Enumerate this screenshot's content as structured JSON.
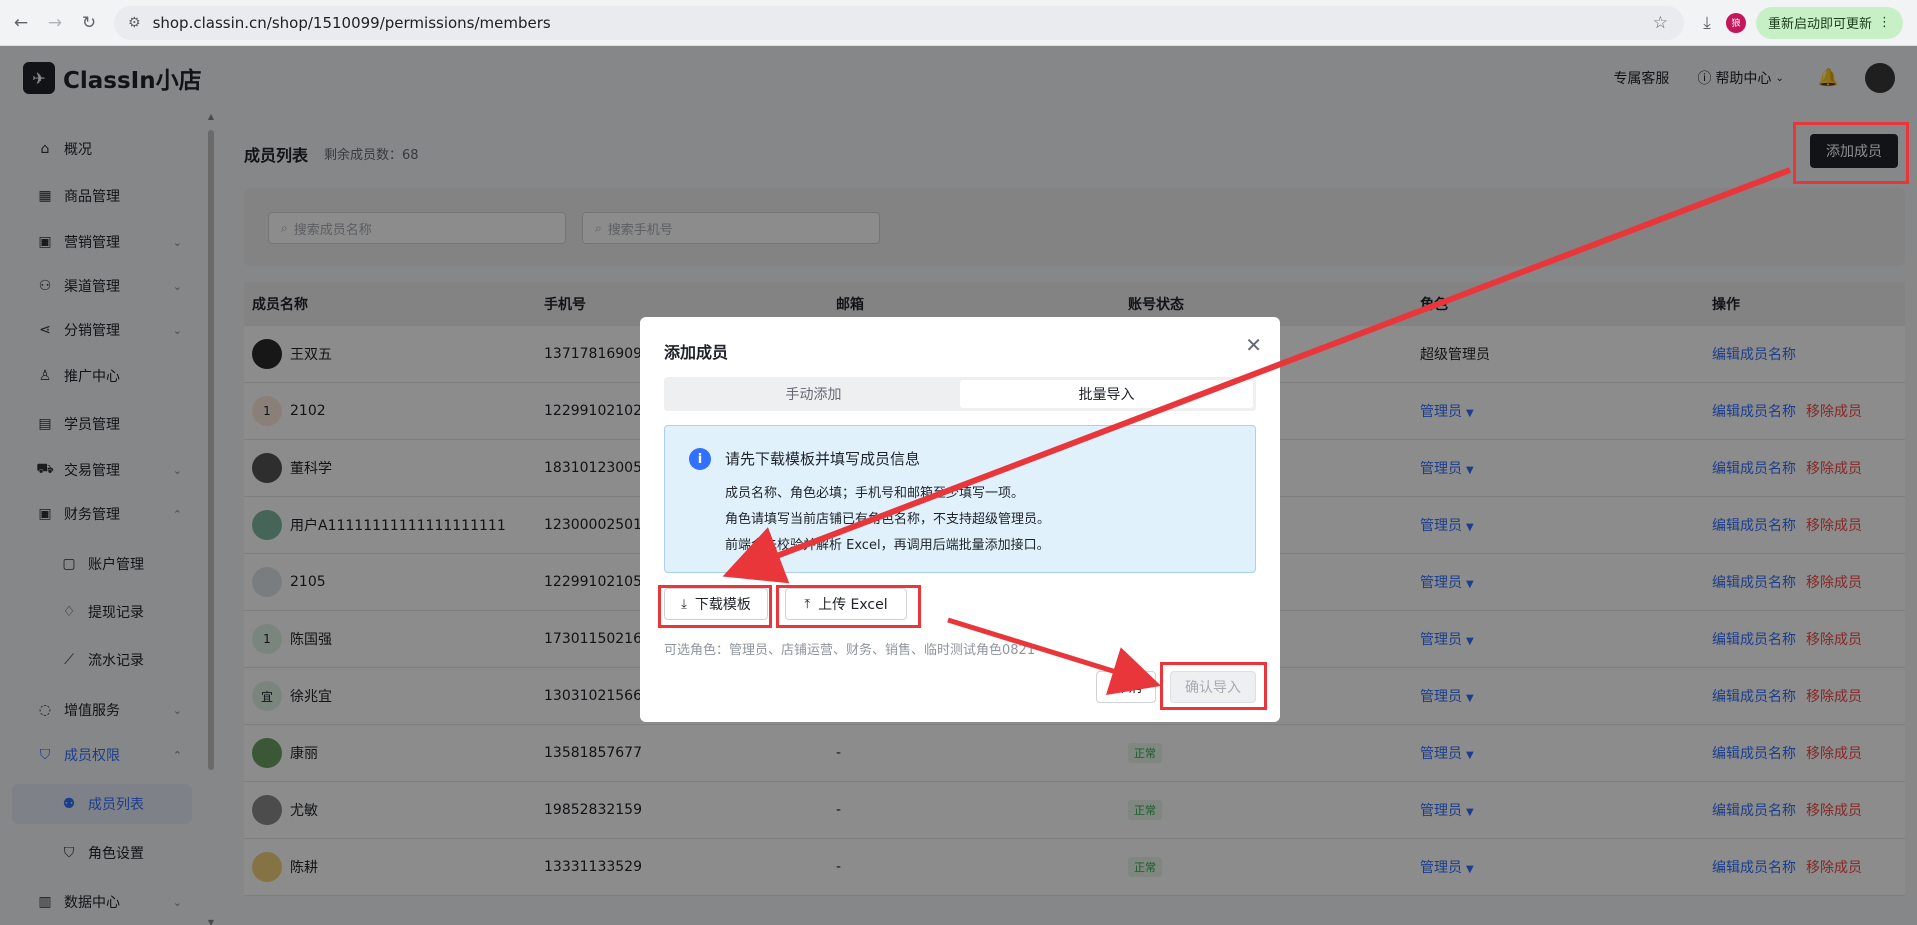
{
  "browser": {
    "url": "shop.classin.cn/shop/1510099/permissions/members",
    "ext_badge": "狼",
    "update_label": "重新启动即可更新"
  },
  "header": {
    "logo_text": "ClassIn小店",
    "service": "专属客服",
    "help": "帮助中心"
  },
  "sidebar": {
    "items": [
      {
        "label": "概况",
        "icon": "home-icon"
      },
      {
        "label": "商品管理",
        "icon": "grid-icon"
      },
      {
        "label": "营销管理",
        "icon": "gift-icon"
      },
      {
        "label": "渠道管理",
        "icon": "channel-icon"
      },
      {
        "label": "分销管理",
        "icon": "share-icon"
      },
      {
        "label": "推广中心",
        "icon": "promo-icon"
      },
      {
        "label": "学员管理",
        "icon": "student-icon"
      },
      {
        "label": "交易管理",
        "icon": "cart-icon"
      },
      {
        "label": "财务管理",
        "icon": "finance-icon"
      },
      {
        "label": "账户管理",
        "icon": "wallet-icon"
      },
      {
        "label": "提现记录",
        "icon": "withdraw-icon"
      },
      {
        "label": "流水记录",
        "icon": "trend-icon"
      },
      {
        "label": "增值服务",
        "icon": "chat-icon"
      },
      {
        "label": "成员权限",
        "icon": "shield-icon"
      },
      {
        "label": "成员列表",
        "icon": "members-icon"
      },
      {
        "label": "角色设置",
        "icon": "role-icon"
      },
      {
        "label": "数据中心",
        "icon": "chart-icon"
      }
    ]
  },
  "main": {
    "title": "成员列表",
    "remaining": "剩余成员数：68",
    "add_button": "添加成员",
    "search_name_placeholder": "搜索成员名称",
    "search_phone_placeholder": "搜索手机号",
    "columns": [
      "成员名称",
      "手机号",
      "邮箱",
      "账号状态",
      "角色",
      "操作"
    ],
    "rows": [
      {
        "name": "王双五",
        "phone": "13717816909",
        "email": "",
        "status": "",
        "role": "超级管理员",
        "edit": "编辑成员名称",
        "remove": "",
        "avatar_text": "",
        "avatar_color": "#2b2b2b"
      },
      {
        "name": "2102",
        "phone": "12299102102",
        "email": "",
        "status": "",
        "role": "管理员",
        "edit": "编辑成员名称",
        "remove": "移除成员",
        "avatar_text": "1",
        "avatar_color": "#fbe9dd"
      },
      {
        "name": "董科学",
        "phone": "18310123005",
        "email": "",
        "status": "",
        "role": "管理员",
        "edit": "编辑成员名称",
        "remove": "移除成员",
        "avatar_text": "",
        "avatar_color": "#555555"
      },
      {
        "name": "用户A11111111111111111111",
        "phone": "12300002501",
        "email": "",
        "status": "",
        "role": "管理员",
        "edit": "编辑成员名称",
        "remove": "移除成员",
        "avatar_text": "",
        "avatar_color": "#7fb8a0"
      },
      {
        "name": "2105",
        "phone": "12299102105",
        "email": "",
        "status": "",
        "role": "管理员",
        "edit": "编辑成员名称",
        "remove": "移除成员",
        "avatar_text": "",
        "avatar_color": "#dfe3ea"
      },
      {
        "name": "陈国强",
        "phone": "17301150216",
        "email": "",
        "status": "",
        "role": "管理员",
        "edit": "编辑成员名称",
        "remove": "移除成员",
        "avatar_text": "1",
        "avatar_color": "#dff3e4"
      },
      {
        "name": "徐兆宜",
        "phone": "13031021566",
        "email": "",
        "status": "",
        "role": "管理员",
        "edit": "编辑成员名称",
        "remove": "移除成员",
        "avatar_text": "宜",
        "avatar_color": "#dff3e4"
      },
      {
        "name": "康丽",
        "phone": "13581857677",
        "email": "-",
        "status": "正常",
        "role": "管理员",
        "edit": "编辑成员名称",
        "remove": "移除成员",
        "avatar_text": "",
        "avatar_color": "#6aa063"
      },
      {
        "name": "尤敏",
        "phone": "19852832159",
        "email": "-",
        "status": "正常",
        "role": "管理员",
        "edit": "编辑成员名称",
        "remove": "移除成员",
        "avatar_text": "",
        "avatar_color": "#8a8a8a"
      },
      {
        "name": "陈耕",
        "phone": "13331133529",
        "email": "-",
        "status": "正常",
        "role": "管理员",
        "edit": "编辑成员名称",
        "remove": "移除成员",
        "avatar_text": "",
        "avatar_color": "#f3d27a"
      }
    ]
  },
  "dialog": {
    "title": "添加成员",
    "tab_manual": "手动添加",
    "tab_batch": "批量导入",
    "info_title": "请先下载模板并填写成员信息",
    "info_lines": [
      "成员名称、角色必填；手机号和邮箱至少填写一项。",
      "角色请填写当前店铺已有角色名称，不支持超级管理员。",
      "前端会先校验并解析 Excel，再调用后端批量添加接口。"
    ],
    "download_label": "下载模板",
    "upload_label": "上传 Excel",
    "roles_hint": "可选角色：管理员、店铺运营、财务、销售、临时测试角色0821",
    "cancel_label": "取 消",
    "confirm_label": "确认导入"
  }
}
